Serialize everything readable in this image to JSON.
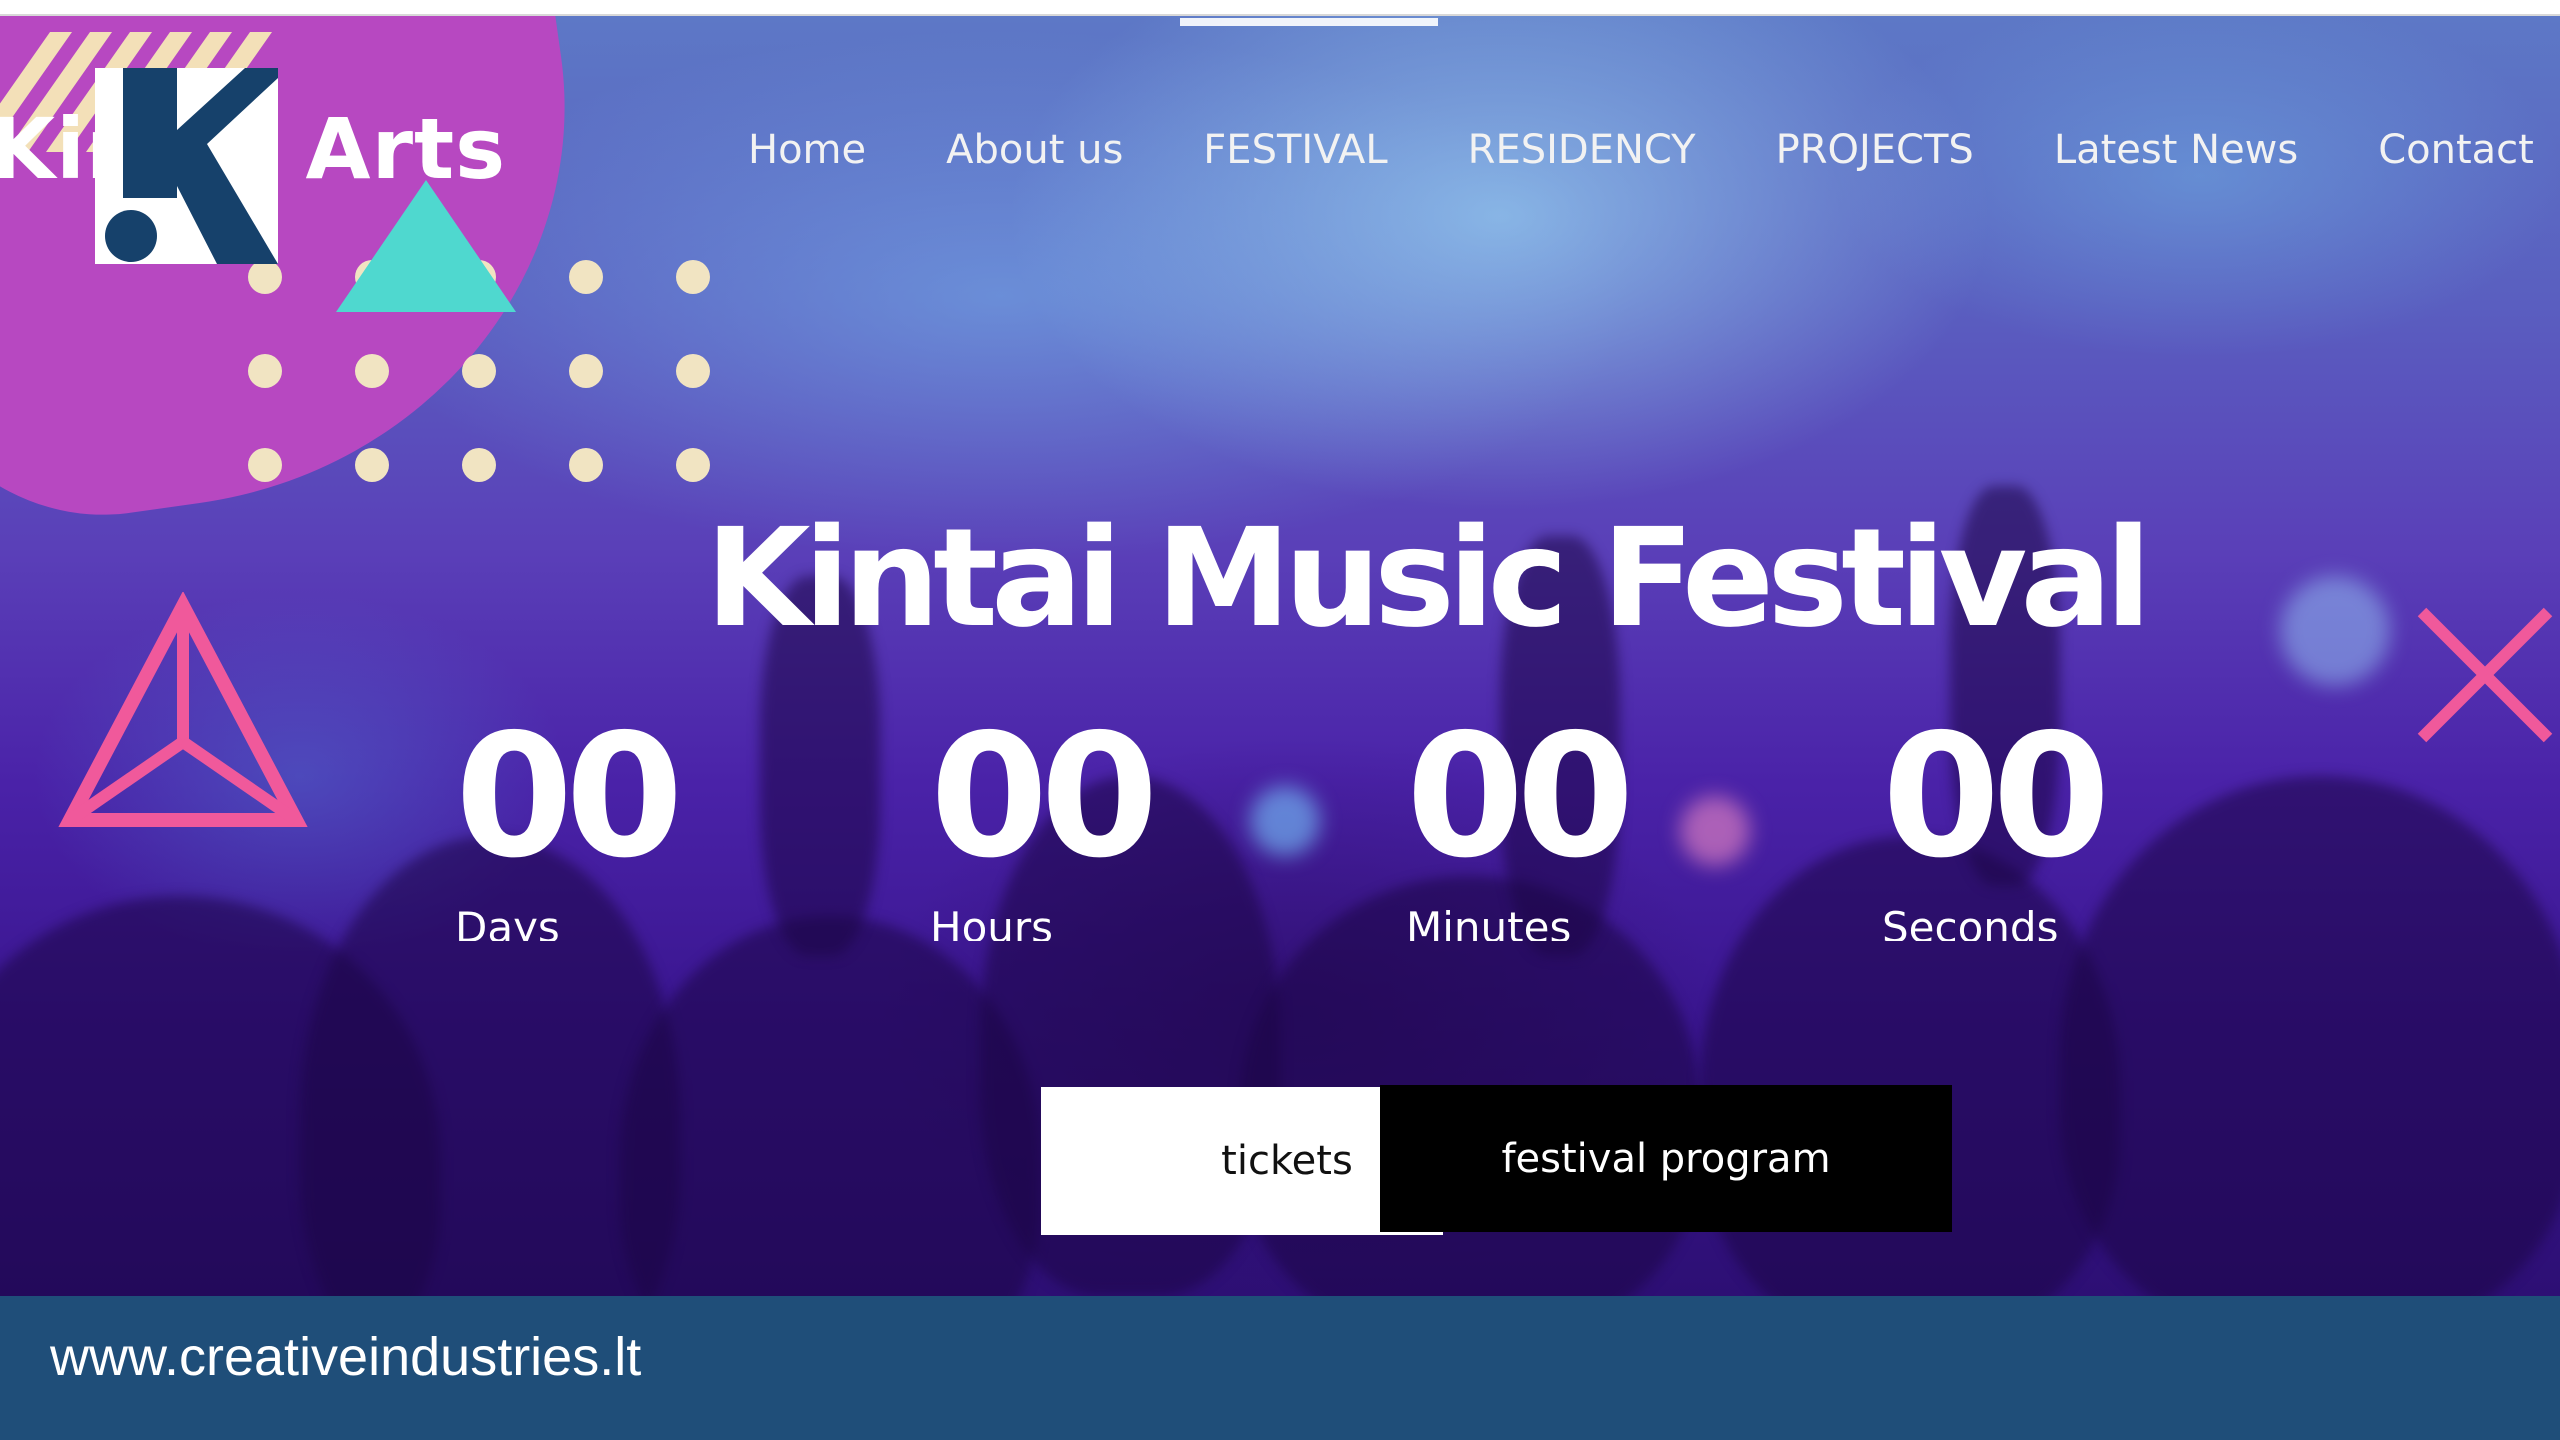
{
  "brand": {
    "logo_letter": "K",
    "name": "Kintai Arts",
    "logo_color": "#16416b"
  },
  "nav": {
    "items": [
      "Home",
      "About us",
      "FESTIVAL",
      "RESIDENCY",
      "PROJECTS",
      "Latest News",
      "Contact"
    ]
  },
  "hero": {
    "title": "Kintai Music Festival"
  },
  "countdown": [
    {
      "value": "00",
      "label": "Days"
    },
    {
      "value": "00",
      "label": "Hours"
    },
    {
      "value": "00",
      "label": "Minutes"
    },
    {
      "value": "00",
      "label": "Seconds"
    }
  ],
  "buttons": {
    "tickets": "tickets",
    "program": "festival program"
  },
  "footer": {
    "url": "www.creativeindustries.lt"
  },
  "colors": {
    "accent_pink": "#f0599b",
    "accent_teal": "#4fd8cf",
    "blob_magenta": "#b748c1",
    "footer_blue": "#1f4e79"
  },
  "icons": [
    "pink-triangle-decor-icon",
    "teal-triangle-decor-icon",
    "pink-x-decor-icon"
  ]
}
